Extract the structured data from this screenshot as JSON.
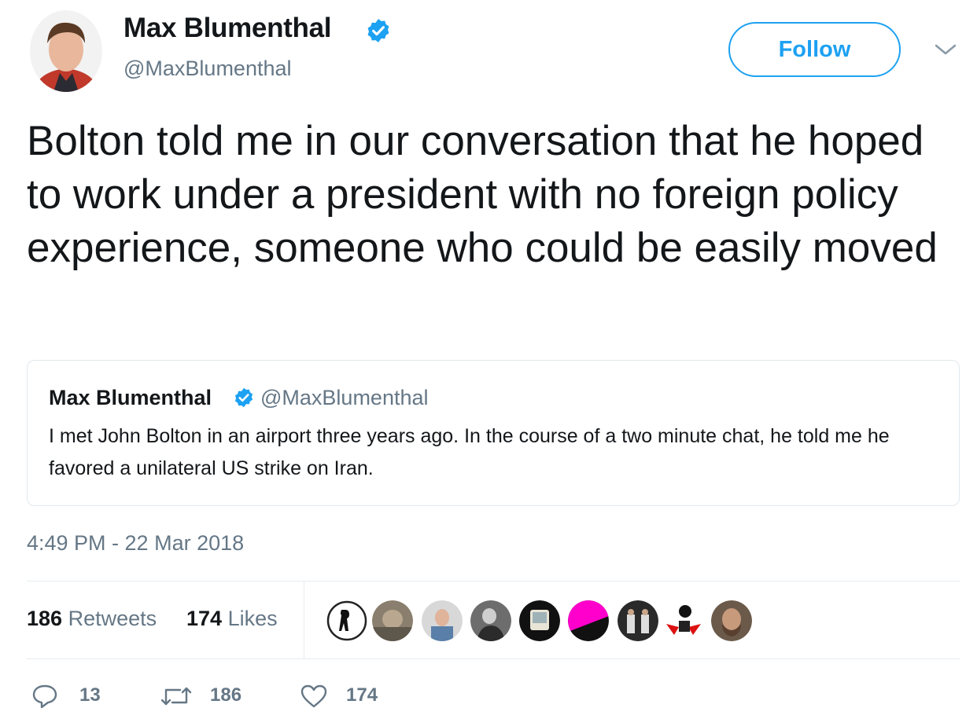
{
  "author": {
    "name": "Max Blumenthal",
    "handle": "@MaxBlumenthal",
    "verified_color": "#1da1f2"
  },
  "follow_button": {
    "label": "Follow",
    "color": "#1da1f2"
  },
  "menu": {
    "icon": "chevron-down-icon"
  },
  "tweet": {
    "text": "Bolton told me in our conversation that he hoped to work under a president with no foreign policy experience, someone who could be easily moved"
  },
  "quoted_tweet": {
    "name": "Max Blumenthal",
    "handle": "@MaxBlumenthal",
    "text": "I met John Bolton in an airport three years ago. In the course of a two minute chat, he told me he favored a unilateral US strike on Iran."
  },
  "timestamp": "4:49 PM - 22 Mar 2018",
  "stats": {
    "retweets_count": "186",
    "retweets_label": "Retweets",
    "likes_count": "174",
    "likes_label": "Likes"
  },
  "favoriters": [
    {
      "name": "favoriter-avatar-1"
    },
    {
      "name": "favoriter-avatar-2"
    },
    {
      "name": "favoriter-avatar-3"
    },
    {
      "name": "favoriter-avatar-4"
    },
    {
      "name": "favoriter-avatar-5"
    },
    {
      "name": "favoriter-avatar-6"
    },
    {
      "name": "favoriter-avatar-7"
    },
    {
      "name": "favoriter-avatar-8"
    },
    {
      "name": "favoriter-avatar-9"
    }
  ],
  "actions": {
    "reply": {
      "icon": "reply-icon",
      "count": "13"
    },
    "retweet": {
      "icon": "retweet-icon",
      "count": "186"
    },
    "like": {
      "icon": "heart-icon",
      "count": "174"
    }
  },
  "colors": {
    "text": "#14171a",
    "secondary": "#657786",
    "border": "#e1e8ed",
    "accent": "#1da1f2"
  }
}
